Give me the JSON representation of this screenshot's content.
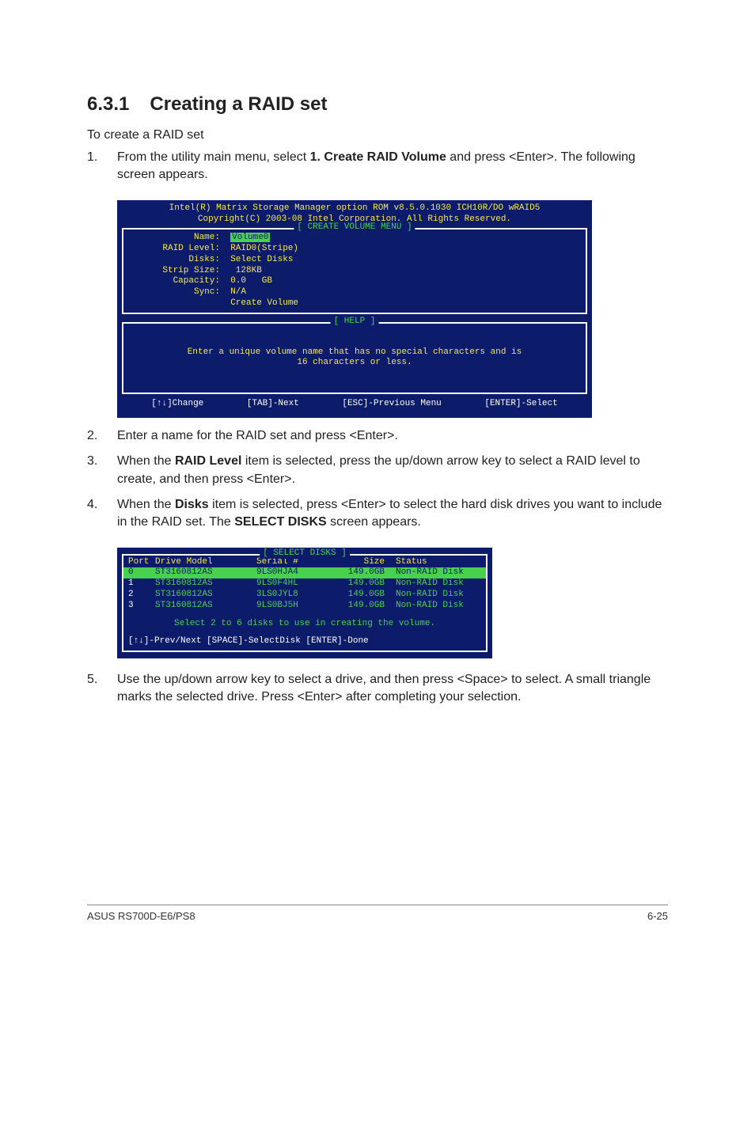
{
  "section": {
    "number": "6.3.1",
    "title": "Creating a RAID set"
  },
  "intro": "To create a RAID set",
  "steps": [
    {
      "n": "1.",
      "pre": "From the utility main menu, select ",
      "bold": "1. Create RAID Volume",
      "post": " and press <Enter>. The following screen appears."
    },
    {
      "n": "2.",
      "pre": "Enter a name for the RAID set and press <Enter>.",
      "bold": "",
      "post": ""
    },
    {
      "n": "3.",
      "pre": "When the ",
      "bold": "RAID Level",
      "post": " item is selected, press the up/down arrow key to select a RAID level to create, and then press <Enter>."
    },
    {
      "n": "4.",
      "pre": "When the ",
      "bold": "Disks",
      "post": " item is selected, press <Enter> to select the hard disk drives you want to include in the RAID set. The ",
      "bold2": "SELECT DISKS",
      "post2": " screen appears."
    },
    {
      "n": "5.",
      "pre": "Use the up/down arrow key to select a drive, and then press <Space> to select. A small triangle marks the selected drive. Press <Enter> after completing your selection.",
      "bold": "",
      "post": ""
    }
  ],
  "console1": {
    "header_line1": "Intel(R) Matrix Storage Manager option ROM v8.5.0.1030 ICH10R/DO wRAID5",
    "header_line2": "Copyright(C) 2003-08 Intel Corporation.  All Rights Reserved.",
    "panel1_title": "[ CREATE VOLUME MENU ]",
    "fields": {
      "name_label": "Name:",
      "name_value": "Volume0",
      "raid_label": "RAID Level:",
      "raid_value": "RAID0(Stripe)",
      "disks_label": "Disks:",
      "disks_value": "Select Disks",
      "strip_label": "Strip Size:",
      "strip_value": " 128KB",
      "cap_label": "Capacity:",
      "cap_value": "0.0   GB",
      "sync_label": "Sync:",
      "sync_value": "N/A",
      "create_label": "Create Volume"
    },
    "panel2_title": "[ HELP ]",
    "help_line1": "Enter a unique volume name that has no special characters and is",
    "help_line2": "16 characters or less.",
    "keys": {
      "change": "[↑↓]Change",
      "next": "[TAB]-Next",
      "prev": "[ESC]-Previous Menu",
      "select": "[ENTER]-Select"
    }
  },
  "console2": {
    "title": "[ SELECT DISKS ]",
    "headers": {
      "port": "Port",
      "model": "Drive Model",
      "serial": "Serial #",
      "size": "Size",
      "status": "Status"
    },
    "rows": [
      {
        "port": "0",
        "model": "ST3160812AS",
        "serial": "9LS0HJA4",
        "size": "149.0GB",
        "status": "Non-RAID Disk",
        "hl": true
      },
      {
        "port": "1",
        "model": "ST3160812AS",
        "serial": "9LS0F4HL",
        "size": "149.0GB",
        "status": "Non-RAID Disk",
        "hl": false
      },
      {
        "port": "2",
        "model": "ST3160812AS",
        "serial": "3LS0JYL8",
        "size": "149.0GB",
        "status": "Non-RAID Disk",
        "hl": false
      },
      {
        "port": "3",
        "model": "ST3160812AS",
        "serial": "9LS0BJ5H",
        "size": "149.0GB",
        "status": "Non-RAID Disk",
        "hl": false
      }
    ],
    "hint": "Select 2 to 6 disks to use in creating the volume.",
    "footer": "[↑↓]-Prev/Next [SPACE]-SelectDisk [ENTER]-Done"
  },
  "page_footer": {
    "left": "ASUS RS700D-E6/PS8",
    "right": "6-25"
  }
}
